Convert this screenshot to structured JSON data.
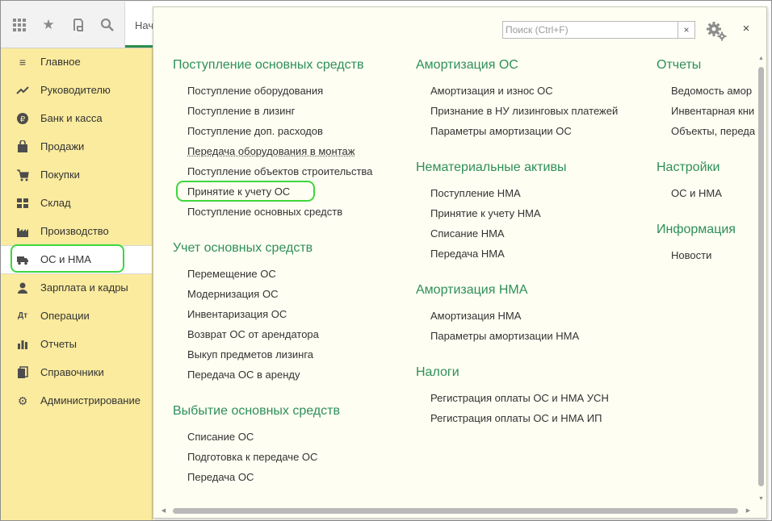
{
  "toolbar": {
    "icons": [
      "apps-grid-icon",
      "favorites-star-icon",
      "history-icon",
      "search-icon"
    ],
    "tab_label": "Нача"
  },
  "sidebar": {
    "items": [
      {
        "label": "Главное",
        "icon": "menu-lines-icon"
      },
      {
        "label": "Руководителю",
        "icon": "trend-icon"
      },
      {
        "label": "Банк и касса",
        "icon": "ruble-coin-icon"
      },
      {
        "label": "Продажи",
        "icon": "shopping-bag-icon"
      },
      {
        "label": "Покупки",
        "icon": "shopping-cart-icon"
      },
      {
        "label": "Склад",
        "icon": "warehouse-icon"
      },
      {
        "label": "Производство",
        "icon": "factory-icon"
      },
      {
        "label": "ОС и НМА",
        "icon": "truck-icon",
        "active": true
      },
      {
        "label": "Зарплата и кадры",
        "icon": "person-icon"
      },
      {
        "label": "Операции",
        "icon": "debit-credit-icon"
      },
      {
        "label": "Отчеты",
        "icon": "bar-chart-icon"
      },
      {
        "label": "Справочники",
        "icon": "books-icon"
      },
      {
        "label": "Администрирование",
        "icon": "gear-icon"
      }
    ]
  },
  "panel": {
    "search_placeholder": "Поиск (Ctrl+F)",
    "search_value": "",
    "clear_label": "×",
    "close_label": "×",
    "columns": [
      {
        "sections": [
          {
            "title": "Поступление основных средств",
            "links": [
              "Поступление оборудования",
              "Поступление в лизинг",
              "Поступление доп. расходов",
              "Передача оборудования в монтаж",
              "Поступление объектов строительства",
              "Принятие к учету ОС",
              "Поступление основных средств"
            ]
          },
          {
            "title": "Учет основных средств",
            "links": [
              "Перемещение ОС",
              "Модернизация ОС",
              "Инвентаризация ОС",
              "Возврат ОС от арендатора",
              "Выкуп предметов лизинга",
              "Передача ОС в аренду"
            ]
          },
          {
            "title": "Выбытие основных средств",
            "links": [
              "Списание ОС",
              "Подготовка к передаче ОС",
              "Передача ОС"
            ]
          }
        ]
      },
      {
        "sections": [
          {
            "title": "Амортизация ОС",
            "links": [
              "Амортизация и износ ОС",
              "Признание в НУ лизинговых платежей",
              "Параметры амортизации ОС"
            ]
          },
          {
            "title": "Нематериальные активы",
            "links": [
              "Поступление НМА",
              "Принятие к учету НМА",
              "Списание НМА",
              "Передача НМА"
            ]
          },
          {
            "title": "Амортизация НМА",
            "links": [
              "Амортизация НМА",
              "Параметры амортизации НМА"
            ]
          },
          {
            "title": "Налоги",
            "links": [
              "Регистрация оплаты ОС и НМА УСН",
              "Регистрация оплаты ОС и НМА ИП"
            ]
          }
        ]
      },
      {
        "sections": [
          {
            "title": "Отчеты",
            "links": [
              "Ведомость амор",
              "Инвентарная кни",
              "Объекты, переда"
            ]
          },
          {
            "title": "Настройки",
            "links": [
              "ОС и НМА"
            ]
          },
          {
            "title": "Информация",
            "links": [
              "Новости"
            ]
          }
        ]
      }
    ]
  },
  "colors": {
    "sidebar_bg": "#fbeb9e",
    "panel_bg": "#fefef2",
    "section_title": "#2e8f58",
    "highlight": "#3fd63f"
  }
}
